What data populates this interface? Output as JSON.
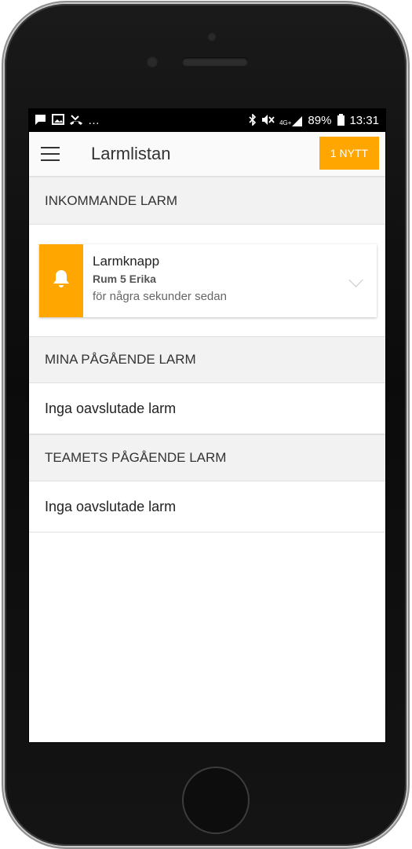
{
  "status_bar": {
    "left_icons": [
      "chat-bubble-icon",
      "image-icon",
      "missed-call-icon"
    ],
    "ellipsis": "…",
    "network_type": "4G+",
    "battery": "89%",
    "time": "13:31",
    "right_icons": [
      "bluetooth-icon",
      "mute-icon",
      "signal-icon",
      "battery-icon"
    ]
  },
  "app_bar": {
    "title": "Larmlistan",
    "new_badge": "1 NYTT",
    "accent_color": "#ffa600"
  },
  "sections": {
    "incoming": {
      "header": "INKOMMANDE LARM",
      "alarm": {
        "title": "Larmknapp",
        "room": "Rum 5 Erika",
        "time": "för några sekunder sedan",
        "icon": "bell-icon"
      }
    },
    "my_ongoing": {
      "header": "MINA PÅGÅENDE LARM",
      "empty": "Inga oavslutade larm"
    },
    "team_ongoing": {
      "header": "TEAMETS PÅGÅENDE LARM",
      "empty": "Inga oavslutade larm"
    }
  }
}
